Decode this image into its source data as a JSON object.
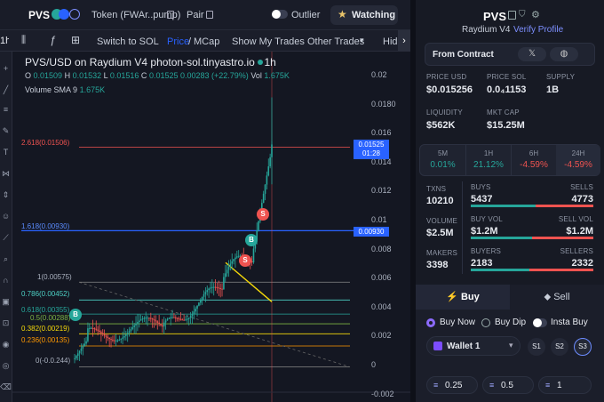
{
  "colors": {
    "accent": "#2962ff",
    "green": "#26a69a",
    "red": "#ef5350",
    "yellow": "#f5d90a",
    "buy_purple": "#7c4dff"
  },
  "header": {
    "pair": "PVS",
    "token_link": "Token (FWAr..pump)",
    "pair_link": "Pair",
    "outlier": "Outlier",
    "watching": "Watching"
  },
  "toolbar": {
    "interval": "1h",
    "switch": "Switch to SOL",
    "price": "Price",
    "slash": "/",
    "mcap": "MCap",
    "show_trades": "Show My Trades",
    "other_trades": "Other Trades",
    "hide": "Hide"
  },
  "legend": {
    "title": "PVS/USD on Raydium V4 photon-sol.tinyastro.io · 1h",
    "o_lbl": "O",
    "o": "0.01509",
    "h_lbl": "H",
    "h": "0.01532",
    "l_lbl": "L",
    "l": "0.01516",
    "c_lbl": "C",
    "c": "0.01525",
    "change": "0.00283 (+22.79%)",
    "vol_lbl": "Vol",
    "vol": "1.675K",
    "volume_line": "Volume SMA 9",
    "volume_val": "1.675K"
  },
  "fib": {
    "l2618": "2.618(0.01506)",
    "l1618": "1.618(0.00930)",
    "l1": "1(0.00575)",
    "l786": "0.786(0.00452)",
    "l618": "0.618(0.00355)",
    "l5": "0.5(0.00288)",
    "l382": "0.382(0.00219)",
    "l236": "0.236(0.00135)",
    "l0": "0(-0.0.244)"
  },
  "price_marker": {
    "value": "0.01525",
    "time": "01:28"
  },
  "fib_marker": "0.00930",
  "markers": {
    "s": "S",
    "b": "B"
  },
  "chart_data": {
    "type": "candlestick",
    "y_ticks": [
      "0.02",
      "0.0180",
      "0.016",
      "0.014",
      "0.012",
      "0.01",
      "0.008",
      "0.006",
      "0.004",
      "0.002",
      "0",
      "-0.002"
    ],
    "ylim": [
      -0.002,
      0.021
    ],
    "current_price": 0.01525
  },
  "right": {
    "token": "PVS",
    "dex": "Raydium V4",
    "verify": "Verify Profile",
    "from_contract": "From Contract",
    "stats": [
      {
        "l": "PRICE USD",
        "v": "$0.015256"
      },
      {
        "l": "PRICE SOL",
        "v": "0.0₄1153"
      },
      {
        "l": "SUPPLY",
        "v": "1B"
      },
      {
        "l": "LIQUIDITY",
        "v": "$562K"
      },
      {
        "l": "MKT CAP",
        "v": "$15.25M"
      }
    ],
    "periods": [
      {
        "l": "5M",
        "v": "0.01%"
      },
      {
        "l": "1H",
        "v": "21.12%"
      },
      {
        "l": "6H",
        "v": "-4.59%"
      },
      {
        "l": "24H",
        "v": "-4.59%"
      }
    ],
    "txns_l": "TXNS",
    "txns": "10210",
    "buys_l": "BUYS",
    "buys": "5437",
    "sells_l": "SELLS",
    "sells": "4773",
    "volume_l": "VOLUME",
    "volume": "$2.5M",
    "buyvol_l": "BUY VOL",
    "buyvol": "$1.2M",
    "sellvol_l": "SELL VOL",
    "sellvol": "$1.2M",
    "makers_l": "MAKERS",
    "makers": "3398",
    "buyers_l": "BUYERS",
    "buyers": "2183",
    "sellers_l": "SELLERS",
    "sellers": "2332",
    "buy_tab": "Buy",
    "sell_tab": "Sell",
    "buy_now": "Buy Now",
    "buy_dip": "Buy Dip",
    "insta": "Insta Buy",
    "wallet": "Wallet 1",
    "s1": "S1",
    "s2": "S2",
    "s3": "S3",
    "amt1": "0.25",
    "amt2": "0.5",
    "amt3": "1"
  }
}
